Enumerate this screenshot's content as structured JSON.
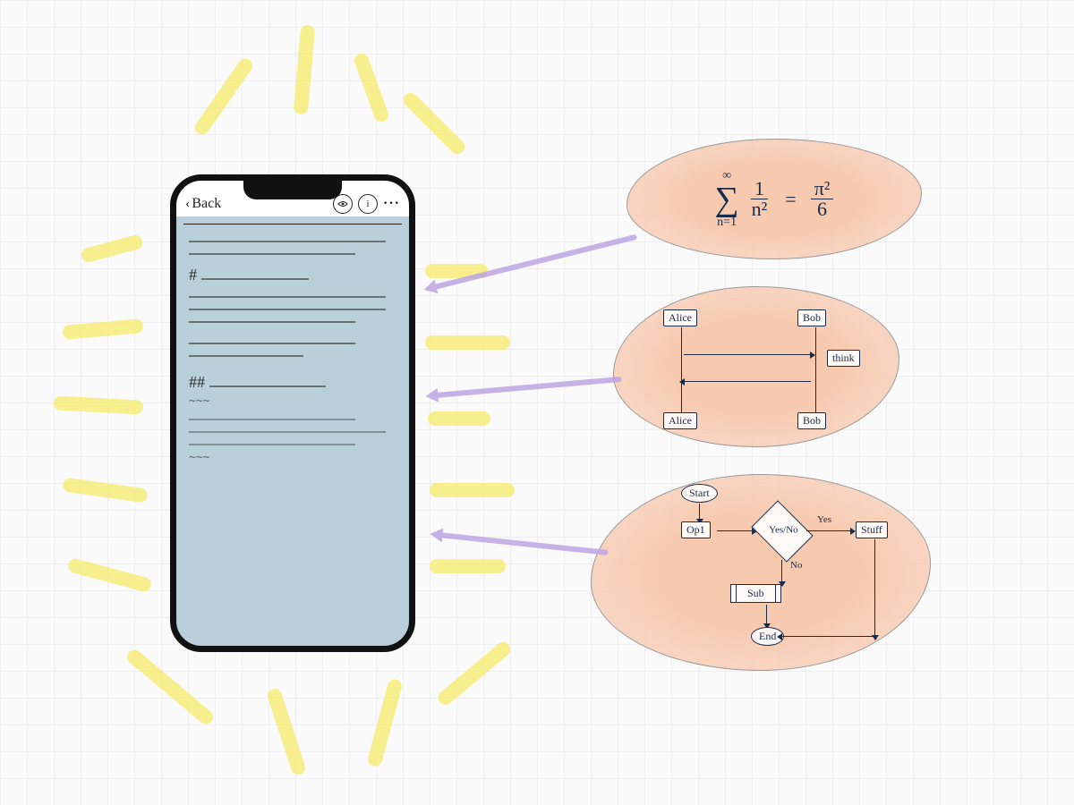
{
  "phone": {
    "back_label": "Back",
    "heading1_prefix": "#",
    "heading2_prefix": "##",
    "code_tilde": "~~~"
  },
  "bubbles": {
    "formula": {
      "sigma_top": "∞",
      "sigma_bottom": "n=1",
      "lhs_num": "1",
      "lhs_den": "n²",
      "eq": "=",
      "rhs_num": "π²",
      "rhs_den": "6"
    },
    "sequence": {
      "p1": "Alice",
      "p2": "Bob",
      "note": "think",
      "p1b": "Alice",
      "p2b": "Bob"
    },
    "flow": {
      "start": "Start",
      "op1": "Op1",
      "decision": "Yes/No",
      "yes": "Yes",
      "no": "No",
      "stuff": "Stuff",
      "sub": "Sub",
      "end": "End"
    }
  }
}
